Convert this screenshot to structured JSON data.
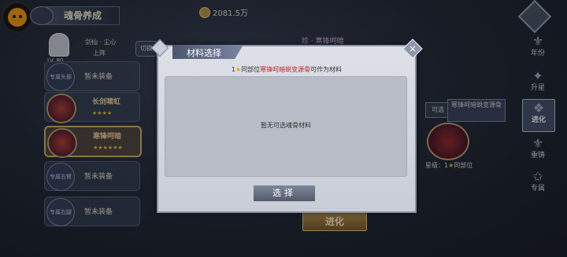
{
  "header": {
    "title": "魂骨养成",
    "currency_value": "2081.5万"
  },
  "character": {
    "name": "剑仙 · 尘心",
    "status": "上阵",
    "level": "LV. 80",
    "switch_label": "切换"
  },
  "slots": [
    {
      "label": "暂未装备",
      "sub": "专属头部",
      "filled": false
    },
    {
      "label": "长剑啸虹",
      "stars": "★★★★",
      "filled": true
    },
    {
      "label": "寒锋呵暗",
      "stars": "★★★★★★",
      "filled": true,
      "selected": true
    },
    {
      "label": "暂未装备",
      "sub": "专属右臂",
      "filled": false
    },
    {
      "label": "暂未装备",
      "sub": "专属右腿",
      "filled": false
    }
  ],
  "detail": {
    "item_title": "珍 · 寒锋呵暗",
    "available_tag": "可选",
    "material_name": "寒锋呵暗蜕变源骨",
    "star_label_prefix": "星级：1",
    "star_icon": "★",
    "star_label_suffix": "同部位",
    "evolve_button": "进化"
  },
  "nav": [
    {
      "label": "年份",
      "icon": "year-icon"
    },
    {
      "label": "升星",
      "icon": "star-up-icon"
    },
    {
      "label": "进化",
      "icon": "evolve-icon",
      "active": true
    },
    {
      "label": "重铸",
      "icon": "recast-icon"
    },
    {
      "label": "专属",
      "icon": "exclusive-icon"
    }
  ],
  "modal": {
    "title": "材料选择",
    "hint_prefix": "1",
    "hint_star": "★",
    "hint_mid": "同部位",
    "hint_item": "寒锋呵暗蜕变源骨",
    "hint_suffix": "可作为材料",
    "empty_text": "暂无可选魂骨材料",
    "select_button": "选择",
    "close_icon": "×"
  },
  "colors": {
    "accent_gold": "#d9b269",
    "star_yellow": "#f2c23a",
    "highlight_red": "#c0262a"
  }
}
